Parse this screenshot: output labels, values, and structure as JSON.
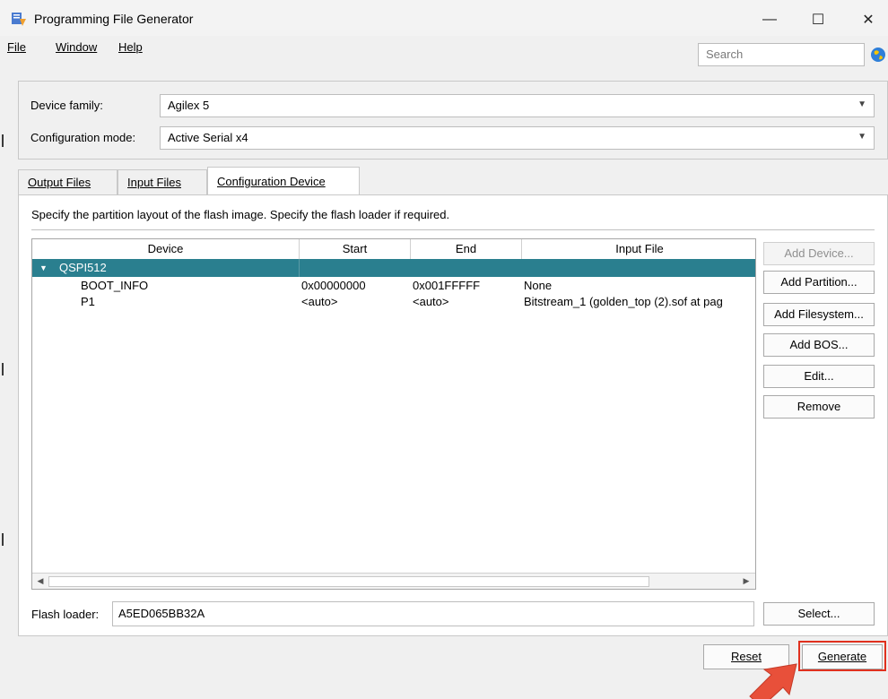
{
  "window": {
    "title": "Programming File Generator",
    "controls": {
      "minimize": "—",
      "maximize": "☐",
      "close": "✕"
    }
  },
  "menubar": {
    "items": [
      "File",
      "Window",
      "Help"
    ],
    "search_placeholder": "Search"
  },
  "device": {
    "family_label": "Device family:",
    "family_value": "Agilex 5",
    "mode_label": "Configuration mode:",
    "mode_value": "Active Serial x4"
  },
  "tabs": [
    "Output Files",
    "Input Files",
    "Configuration Device"
  ],
  "active_tab": "Configuration Device",
  "panel": {
    "instructions": "Specify the partition layout of the flash image. Specify the flash loader if required."
  },
  "table": {
    "columns": [
      "Device",
      "Start",
      "End",
      "Input File"
    ],
    "group": "QSPI512",
    "rows": [
      {
        "device": "BOOT_INFO",
        "start": "0x00000000",
        "end": "0x001FFFFF",
        "input_file": "None"
      },
      {
        "device": "P1",
        "start": "<auto>",
        "end": "<auto>",
        "input_file": "Bitstream_1 (golden_top (2).sof at pag"
      }
    ]
  },
  "side_buttons": {
    "add_device": "Add Device...",
    "add_partition": "Add Partition...",
    "add_filesystem": "Add Filesystem...",
    "add_bos": "Add BOS...",
    "edit": "Edit...",
    "remove": "Remove"
  },
  "flash_loader": {
    "label": "Flash loader:",
    "value": "A5ED065BB32A",
    "select_button": "Select..."
  },
  "footer": {
    "reset": "Reset",
    "generate": "Generate"
  },
  "colors": {
    "selection": "#2a7f8f",
    "highlight": "#e0301e",
    "arrow": "#e8503a"
  }
}
